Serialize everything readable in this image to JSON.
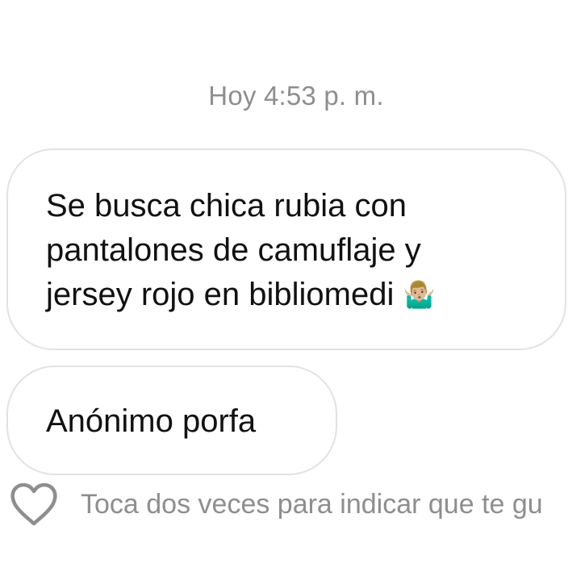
{
  "conversation": {
    "timestamp": "Hoy 4:53 p. m.",
    "messages": [
      {
        "text": "Se busca chica rubia con\npantalones de camuflaje y\njersey rojo en bibliomedi ",
        "emoji": "🤷🏼‍♂️"
      },
      {
        "text": "Anónimo porfa"
      }
    ]
  },
  "like_bar": {
    "icon": "heart-outline-icon",
    "hint": "Toca dos veces para indicar que te gu"
  },
  "colors": {
    "background": "#ffffff",
    "bubble_border": "#e2e2e2",
    "text": "#111111",
    "muted": "#8e8e8e"
  }
}
